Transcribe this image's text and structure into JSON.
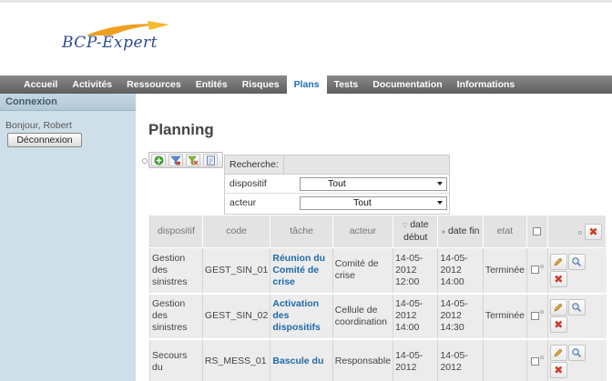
{
  "app": {
    "logo_text": "BCP-Expert",
    "brand_color": "#2b4a8c",
    "accent_color": "#f0a020"
  },
  "nav": {
    "items": [
      "Accueil",
      "Activités",
      "Ressources",
      "Entités",
      "Risques",
      "Plans",
      "Tests",
      "Documentation",
      "Informations"
    ],
    "active": "Plans"
  },
  "sidebar": {
    "section_title": "Connexion",
    "greeting": "Bonjour, Robert",
    "logout_label": "Déconnexion"
  },
  "main": {
    "title": "Planning"
  },
  "toolbar": {
    "icons": [
      "add-icon",
      "filter-icon",
      "clear-filter-icon",
      "export-icon"
    ]
  },
  "search": {
    "header": "Recherche:",
    "fields": [
      {
        "label": "dispositif",
        "value": "Tout"
      },
      {
        "label": "acteur",
        "value": "Tout"
      }
    ]
  },
  "grid": {
    "columns": [
      "dispositif",
      "code",
      "tâche",
      "acteur",
      "date début",
      "date fin",
      "etat"
    ],
    "rows": [
      {
        "dispositif": "Gestion des sinistres",
        "code": "GEST_SIN_01",
        "tache": "Réunion du Comité de crise",
        "acteur": "Comité de crise",
        "date_debut": "14-05-2012 12:00",
        "date_fin": "14-05-2012 14:00",
        "etat": "Terminée"
      },
      {
        "dispositif": "Gestion des sinistres",
        "code": "GEST_SIN_02",
        "tache": "Activation des dispositifs",
        "acteur": "Cellule de coordination",
        "date_debut": "14-05-2012 14:00",
        "date_fin": "14-05-2012 14:30",
        "etat": "Terminée"
      },
      {
        "dispositif": "Secours du",
        "code": "RS_MESS_01",
        "tache": "Bascule du",
        "acteur": "Responsable",
        "date_debut": "14-05-2012",
        "date_fin": "14-05-2012",
        "etat": ""
      }
    ]
  }
}
